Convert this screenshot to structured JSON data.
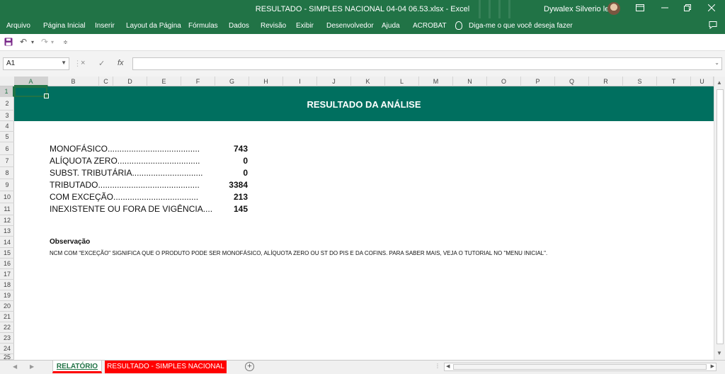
{
  "window": {
    "title": "RESULTADO - SIMPLES NACIONAL 04-04 06.53.xlsx  -  Excel",
    "user": "Dywalex Silverio leles"
  },
  "menu": {
    "items": [
      "Arquivo",
      "Página Inicial",
      "Inserir",
      "Layout da Página",
      "Fórmulas",
      "Dados",
      "Revisão",
      "Exibir",
      "Desenvolvedor",
      "Ajuda",
      "ACROBAT"
    ],
    "tell_me": "Diga-me o que você deseja fazer"
  },
  "formula_bar": {
    "name_box": "A1",
    "cancel_icon": "×",
    "enter_icon": "✓",
    "fx_label": "fx",
    "formula": ""
  },
  "columns": [
    "A",
    "B",
    "C",
    "D",
    "E",
    "F",
    "G",
    "H",
    "I",
    "J",
    "K",
    "L",
    "M",
    "N",
    "O",
    "P",
    "Q",
    "R",
    "S",
    "T",
    "U"
  ],
  "rows": [
    "1",
    "2",
    "3",
    "4",
    "5",
    "6",
    "7",
    "8",
    "9",
    "10",
    "11",
    "12",
    "13",
    "14",
    "15",
    "16",
    "17",
    "18",
    "19",
    "20",
    "21",
    "22",
    "23",
    "24",
    "25"
  ],
  "report": {
    "title": "RESULTADO DA ANÁLISE",
    "results": [
      {
        "label": "MONOFÁSICO.......................................",
        "value": "743"
      },
      {
        "label": "ALÍQUOTA ZERO...................................",
        "value": "0"
      },
      {
        "label": "SUBST. TRIBUTÁRIA..............................",
        "value": "0"
      },
      {
        "label": "TRIBUTADO...........................................",
        "value": "3384"
      },
      {
        "label": "COM EXCEÇÃO....................................",
        "value": "213"
      },
      {
        "label": "INEXISTENTE OU FORA DE VIGÊNCIA....",
        "value": "145"
      }
    ],
    "observation_title": "Observação",
    "observation_text": "NCM COM \"EXCEÇÃO\" SIGNIFICA QUE O PRODUTO PODE SER MONOFÁSICO, ALÍQUOTA ZERO OU ST DO PIS E DA COFINS. PARA SABER MAIS, VEJA O TUTORIAL NO \"MENU INICIAL\"."
  },
  "sheet_tabs": {
    "active": "RELATÓRIO",
    "other": "RESULTADO - SIMPLES NACIONAL",
    "add_label": "+"
  },
  "colors": {
    "excel_green": "#217346",
    "banner_teal": "#006f5f",
    "tab_red": "#ff0000"
  }
}
